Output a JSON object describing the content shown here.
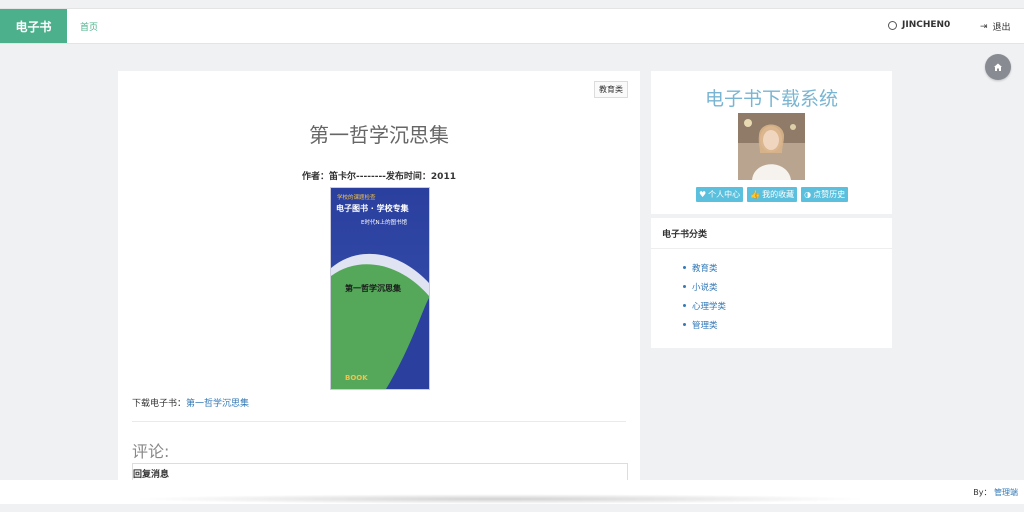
{
  "header": {
    "brand": "电子书",
    "home": "首页",
    "username": "JINCHEN0",
    "logout": "退出"
  },
  "book": {
    "category": "教育类",
    "title": "第一哲学沉思集",
    "meta": "作者：笛卡尔--------发布时间：2011",
    "download_label": "下载电子书：",
    "download_link": "第一哲学沉思集",
    "cover": {
      "line1": "学校的课题检查",
      "line2": "电子图书 · 学校专集",
      "line3": "E时代N上的图书馆",
      "title": "第一哲学沉思集",
      "logo": "BOOK"
    }
  },
  "comments": {
    "heading": "评论:",
    "reply_title": "回复消息"
  },
  "sidebar": {
    "system_title": "电子书下载系统",
    "buttons": [
      {
        "icon": "heart-icon",
        "glyph": "♥",
        "label": "个人中心"
      },
      {
        "icon": "thumbs-up-icon",
        "glyph": "👍",
        "label": "我的收藏"
      },
      {
        "icon": "contrast-icon",
        "glyph": "◑",
        "label": "点赞历史"
      }
    ],
    "categories_heading": "电子书分类",
    "categories": [
      "教育类",
      "小说类",
      "心理学类",
      "管理类"
    ]
  },
  "footer": {
    "by": "By：",
    "link": "管理端"
  },
  "colors": {
    "brand": "#4db08c",
    "accent_button": "#5bc0de",
    "link": "#337ab7",
    "system_title": "#79b5d2"
  }
}
